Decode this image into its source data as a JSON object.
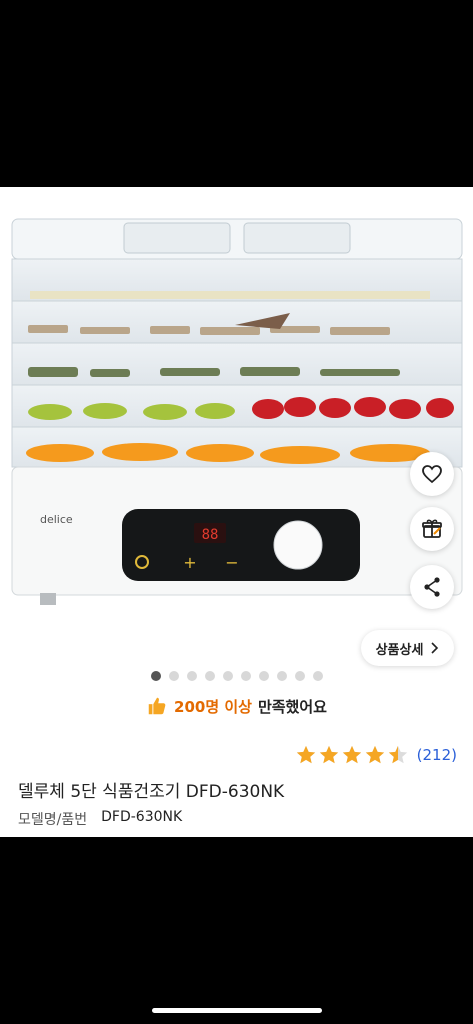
{
  "product": {
    "brand_mark": "delice",
    "display_reading": "88",
    "title": "델루체 5단 식품건조기 DFD-630NK",
    "model_label": "모델명/품번",
    "model_value": "DFD-630NK"
  },
  "gallery": {
    "total_images": 10,
    "current_index": 1
  },
  "buttons": {
    "detail_label": "상품상세"
  },
  "satisfaction": {
    "highlight": "200명 이상",
    "rest": "만족했어요"
  },
  "rating": {
    "stars": 4.5,
    "count": "(212)"
  },
  "icons": {
    "wish": "heart-icon",
    "gift": "gift-icon",
    "share": "share-icon",
    "detail_arrow": "chevron-right-icon",
    "thumb": "thumbs-up-icon"
  },
  "colors": {
    "star": "#f5a623",
    "review_link": "#2a5fd8",
    "highlight": "#e36a00"
  }
}
